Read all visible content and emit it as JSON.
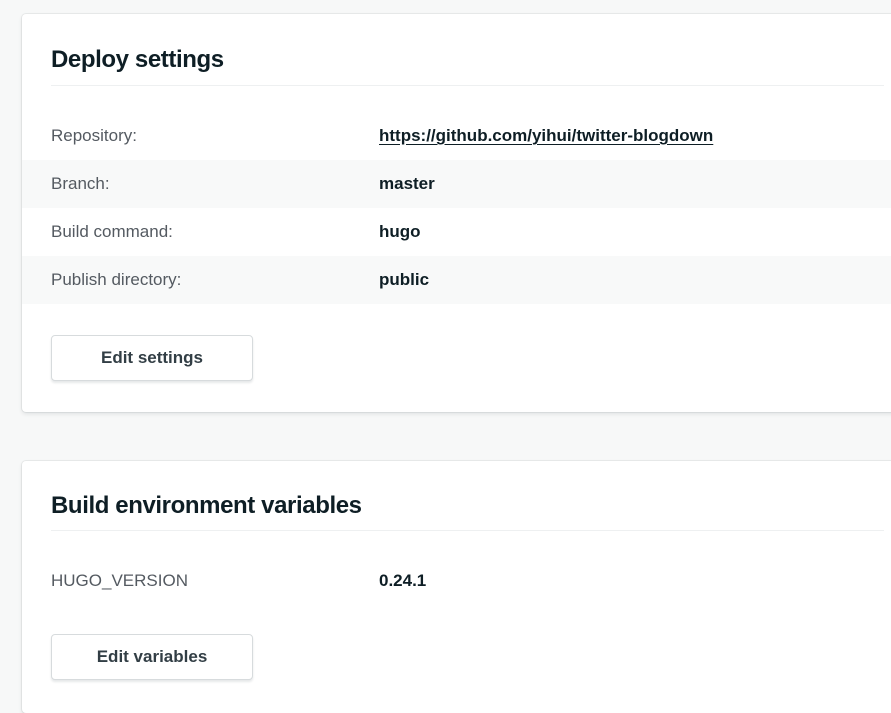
{
  "deploy_settings": {
    "title": "Deploy settings",
    "rows": [
      {
        "label": "Repository:",
        "value": "https://github.com/yihui/twitter-blogdown"
      },
      {
        "label": "Branch:",
        "value": "master"
      },
      {
        "label": "Build command:",
        "value": "hugo"
      },
      {
        "label": "Publish directory:",
        "value": "public"
      }
    ],
    "edit_button_label": "Edit settings"
  },
  "build_env": {
    "title": "Build environment variables",
    "variables": [
      {
        "name": "HUGO_VERSION",
        "value": "0.24.1"
      }
    ],
    "edit_button_label": "Edit variables"
  }
}
